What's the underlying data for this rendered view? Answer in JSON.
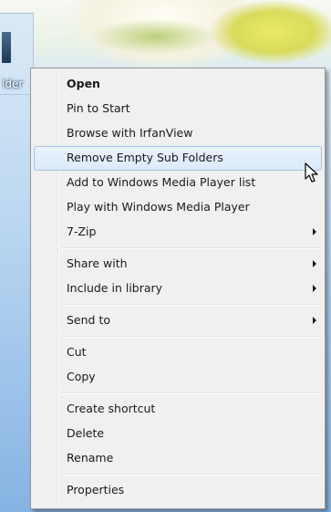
{
  "desktop": {
    "item_label": "lder"
  },
  "context_menu": {
    "groups": [
      {
        "items": [
          {
            "label": "Open",
            "bold": true,
            "submenu": false
          },
          {
            "label": "Pin to Start",
            "submenu": false
          },
          {
            "label": "Browse with IrfanView",
            "submenu": false
          },
          {
            "label": "Remove Empty Sub Folders",
            "submenu": false,
            "highlighted": true
          },
          {
            "label": "Add to Windows Media Player list",
            "submenu": false
          },
          {
            "label": "Play with Windows Media Player",
            "submenu": false
          },
          {
            "label": "7-Zip",
            "submenu": true
          }
        ]
      },
      {
        "items": [
          {
            "label": "Share with",
            "submenu": true
          },
          {
            "label": "Include in library",
            "submenu": true
          }
        ]
      },
      {
        "items": [
          {
            "label": "Send to",
            "submenu": true
          }
        ]
      },
      {
        "items": [
          {
            "label": "Cut",
            "submenu": false
          },
          {
            "label": "Copy",
            "submenu": false
          }
        ]
      },
      {
        "items": [
          {
            "label": "Create shortcut",
            "submenu": false
          },
          {
            "label": "Delete",
            "submenu": false
          },
          {
            "label": "Rename",
            "submenu": false
          }
        ]
      },
      {
        "items": [
          {
            "label": "Properties",
            "submenu": false
          }
        ]
      }
    ]
  },
  "icons": {
    "submenu": "chevron-right-icon",
    "cursor": "mouse-pointer-icon",
    "folder": "folder-icon"
  },
  "colors": {
    "menu_background": "#f0f0f0",
    "highlight_background": "#dbeafb",
    "highlight_border": "#a5c3e8",
    "text": "#1a1a1a"
  }
}
